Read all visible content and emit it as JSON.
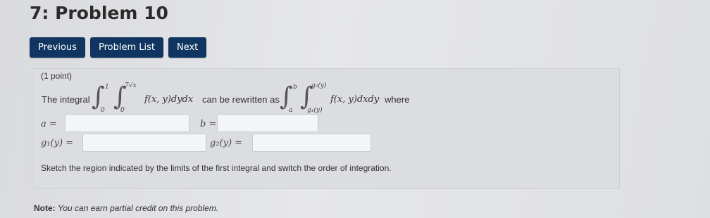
{
  "header": {
    "title": "7: Problem 10"
  },
  "nav": {
    "previous": "Previous",
    "problem_list": "Problem List",
    "next": "Next"
  },
  "problem": {
    "points": "(1 point)",
    "intro": "The integral",
    "integrand1": "f(x, y)dydx",
    "rewrite_text": "can be rewritten as",
    "integrand2": "f(x, y)dxdy",
    "where": "where",
    "limits1": {
      "outer_upper": "1",
      "outer_lower": "0",
      "inner_upper": "7√x",
      "inner_lower": "0"
    },
    "limits2": {
      "outer_upper": "b",
      "outer_lower": "a",
      "inner_upper": "g₂(y)",
      "inner_lower": "g₁(y)"
    },
    "label_a": "a =",
    "label_b": "b =",
    "label_g1": "g₁(y) =",
    "label_g2": "g₂(y) =",
    "inputs": {
      "a": "",
      "b": "",
      "g1": "",
      "g2": ""
    },
    "instruction": "Sketch the region indicated by the limits of the first integral and switch the order of integration."
  },
  "note": {
    "label": "Note:",
    "text": "You can earn partial credit on this problem."
  }
}
